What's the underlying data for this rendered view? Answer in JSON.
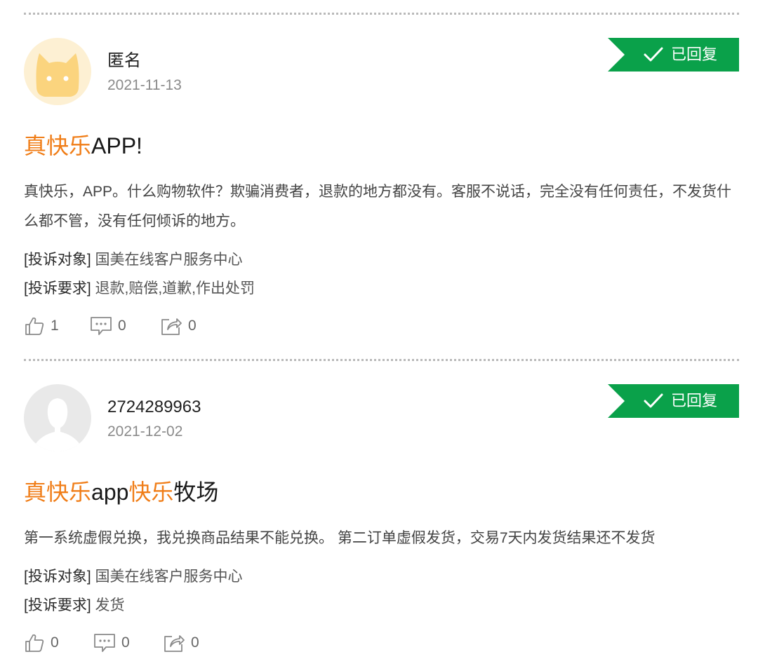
{
  "reviews": [
    {
      "user": "匿名",
      "date": "2021-11-13",
      "status": "已回复",
      "title_parts": [
        {
          "text": "真快乐",
          "highlight": true
        },
        {
          "text": "APP!",
          "highlight": false
        }
      ],
      "body": "真快乐，APP。什么购物软件？欺骗消费者，退款的地方都没有。客服不说话，完全没有任何责任，不发货什么都不管，没有任何倾诉的地方。",
      "target_label": "[投诉对象]",
      "target_value": "国美在线客户服务中心",
      "demand_label": "[投诉要求]",
      "demand_value": "退款,赔偿,道歉,作出处罚",
      "likes": "1",
      "comments": "0",
      "shares": "0",
      "avatar": "cat-avatar"
    },
    {
      "user": "2724289963",
      "date": "2021-12-02",
      "status": "已回复",
      "title_parts": [
        {
          "text": "真快乐",
          "highlight": true
        },
        {
          "text": "app",
          "highlight": false
        },
        {
          "text": "快乐",
          "highlight": true
        },
        {
          "text": "牧场",
          "highlight": false
        }
      ],
      "body": "第一系统虚假兑换，我兑换商品结果不能兑换。 第二订单虚假发货，交易7天内发货结果还不发货",
      "target_label": "[投诉对象]",
      "target_value": "国美在线客户服务中心",
      "demand_label": "[投诉要求]",
      "demand_value": "发货",
      "likes": "0",
      "comments": "0",
      "shares": "0",
      "avatar": "person-avatar"
    }
  ],
  "colors": {
    "accent_orange": "#f07d17",
    "status_green": "#0aa14a"
  }
}
